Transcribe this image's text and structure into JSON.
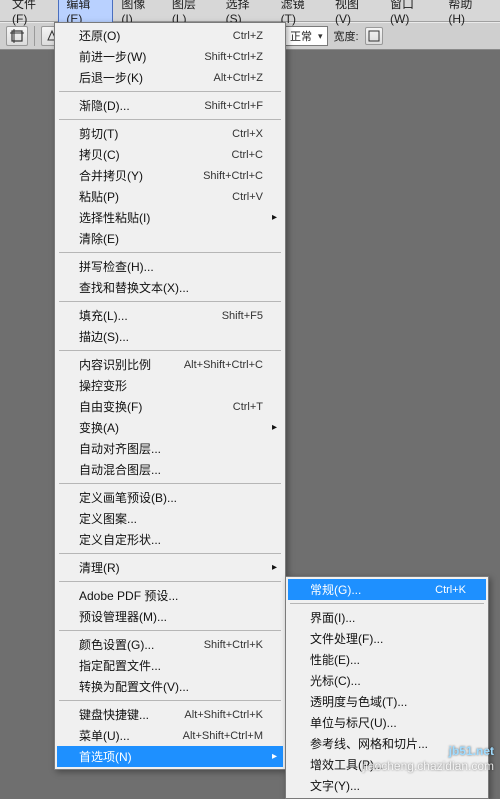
{
  "menubar": [
    {
      "label": "文件(F)",
      "active": false
    },
    {
      "label": "编辑(E)",
      "active": true
    },
    {
      "label": "图像(I)",
      "active": false
    },
    {
      "label": "图层(L)",
      "active": false
    },
    {
      "label": "选择(S)",
      "active": false
    },
    {
      "label": "滤镜(T)",
      "active": false
    },
    {
      "label": "视图(V)",
      "active": false
    },
    {
      "label": "窗口(W)",
      "active": false
    },
    {
      "label": "帮助(H)",
      "active": false
    }
  ],
  "toolbar": {
    "mode_label": "正常",
    "width_label": "宽度:"
  },
  "edit_menu": [
    {
      "label": "还原(O)",
      "shortcut": "Ctrl+Z"
    },
    {
      "label": "前进一步(W)",
      "shortcut": "Shift+Ctrl+Z"
    },
    {
      "label": "后退一步(K)",
      "shortcut": "Alt+Ctrl+Z"
    },
    {
      "sep": true
    },
    {
      "label": "渐隐(D)...",
      "shortcut": "Shift+Ctrl+F"
    },
    {
      "sep": true
    },
    {
      "label": "剪切(T)",
      "shortcut": "Ctrl+X"
    },
    {
      "label": "拷贝(C)",
      "shortcut": "Ctrl+C"
    },
    {
      "label": "合并拷贝(Y)",
      "shortcut": "Shift+Ctrl+C"
    },
    {
      "label": "粘贴(P)",
      "shortcut": "Ctrl+V"
    },
    {
      "label": "选择性粘贴(I)",
      "submenu": true
    },
    {
      "label": "清除(E)"
    },
    {
      "sep": true
    },
    {
      "label": "拼写检查(H)..."
    },
    {
      "label": "查找和替换文本(X)..."
    },
    {
      "sep": true
    },
    {
      "label": "填充(L)...",
      "shortcut": "Shift+F5"
    },
    {
      "label": "描边(S)..."
    },
    {
      "sep": true
    },
    {
      "label": "内容识别比例",
      "shortcut": "Alt+Shift+Ctrl+C"
    },
    {
      "label": "操控变形"
    },
    {
      "label": "自由变换(F)",
      "shortcut": "Ctrl+T"
    },
    {
      "label": "变换(A)",
      "submenu": true
    },
    {
      "label": "自动对齐图层..."
    },
    {
      "label": "自动混合图层..."
    },
    {
      "sep": true
    },
    {
      "label": "定义画笔预设(B)..."
    },
    {
      "label": "定义图案..."
    },
    {
      "label": "定义自定形状..."
    },
    {
      "sep": true
    },
    {
      "label": "清理(R)",
      "submenu": true
    },
    {
      "sep": true
    },
    {
      "label": "Adobe PDF 预设..."
    },
    {
      "label": "预设管理器(M)..."
    },
    {
      "sep": true
    },
    {
      "label": "颜色设置(G)...",
      "shortcut": "Shift+Ctrl+K"
    },
    {
      "label": "指定配置文件..."
    },
    {
      "label": "转换为配置文件(V)..."
    },
    {
      "sep": true
    },
    {
      "label": "键盘快捷键...",
      "shortcut": "Alt+Shift+Ctrl+K"
    },
    {
      "label": "菜单(U)...",
      "shortcut": "Alt+Shift+Ctrl+M"
    },
    {
      "label": "首选项(N)",
      "submenu": true,
      "highlight": true
    }
  ],
  "prefs_menu": [
    {
      "label": "常规(G)...",
      "shortcut": "Ctrl+K",
      "highlight": true
    },
    {
      "sep": true
    },
    {
      "label": "界面(I)..."
    },
    {
      "label": "文件处理(F)..."
    },
    {
      "label": "性能(E)..."
    },
    {
      "label": "光标(C)..."
    },
    {
      "label": "透明度与色域(T)..."
    },
    {
      "label": "单位与标尺(U)..."
    },
    {
      "label": "参考线、网格和切片..."
    },
    {
      "label": "增效工具(P)..."
    },
    {
      "label": "文字(Y)..."
    }
  ],
  "watermark": {
    "brand": "jb51.net",
    "line2": "jiaocheng.chazidian.com"
  }
}
